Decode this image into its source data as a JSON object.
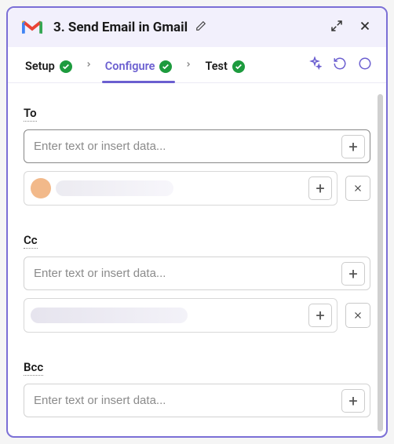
{
  "header": {
    "title": "3. Send Email in Gmail"
  },
  "tabs": {
    "setup": "Setup",
    "configure": "Configure",
    "test": "Test"
  },
  "fields": {
    "to": {
      "label": "To",
      "placeholder": "Enter text or insert data..."
    },
    "cc": {
      "label": "Cc",
      "placeholder": "Enter text or insert data..."
    },
    "bcc": {
      "label": "Bcc",
      "placeholder": "Enter text or insert data..."
    }
  }
}
